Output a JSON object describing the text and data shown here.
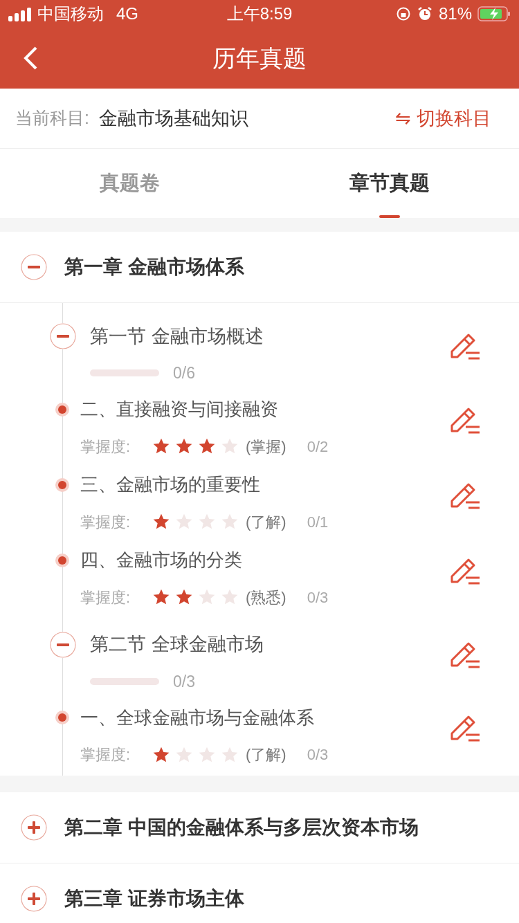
{
  "status_bar": {
    "carrier": "中国移动",
    "network": "4G",
    "time": "上午8:59",
    "battery": "81%"
  },
  "nav": {
    "title": "历年真题"
  },
  "subject": {
    "label": "当前科目:",
    "value": "金融市场基础知识",
    "switch": "⇋ 切换科目"
  },
  "tabs": [
    {
      "label": "真题卷",
      "selected": false
    },
    {
      "label": "章节真题",
      "selected": true
    }
  ],
  "chapters": [
    {
      "title": "第一章 金融市场体系",
      "expanded": true,
      "children": [
        {
          "kind": "section",
          "title": "第一节 金融市场概述",
          "expanded": true,
          "level": 0,
          "count": "0/6",
          "children": [
            {
              "kind": "point",
              "title": "二、直接融资与间接融资",
              "mastery_label": "掌握度:",
              "stars": 3,
              "mastery": "(掌握)",
              "count": "0/2"
            },
            {
              "kind": "point",
              "title": "三、金融市场的重要性",
              "mastery_label": "掌握度:",
              "stars": 1,
              "mastery": "(了解)",
              "count": "0/1"
            },
            {
              "kind": "point",
              "title": "四、金融市场的分类",
              "mastery_label": "掌握度:",
              "stars": 2,
              "mastery": "(熟悉)",
              "count": "0/3"
            }
          ]
        },
        {
          "kind": "section",
          "title": "第二节 全球金融市场",
          "expanded": true,
          "level": 0,
          "count": "0/3",
          "children": [
            {
              "kind": "point",
              "title": "一、全球金融市场与金融体系",
              "mastery_label": "掌握度:",
              "stars": 1,
              "mastery": "(了解)",
              "count": "0/3"
            }
          ]
        }
      ]
    },
    {
      "title": "第二章 中国的金融体系与多层次资本市场",
      "expanded": false
    },
    {
      "title": "第三章 证券市场主体",
      "expanded": false
    }
  ]
}
